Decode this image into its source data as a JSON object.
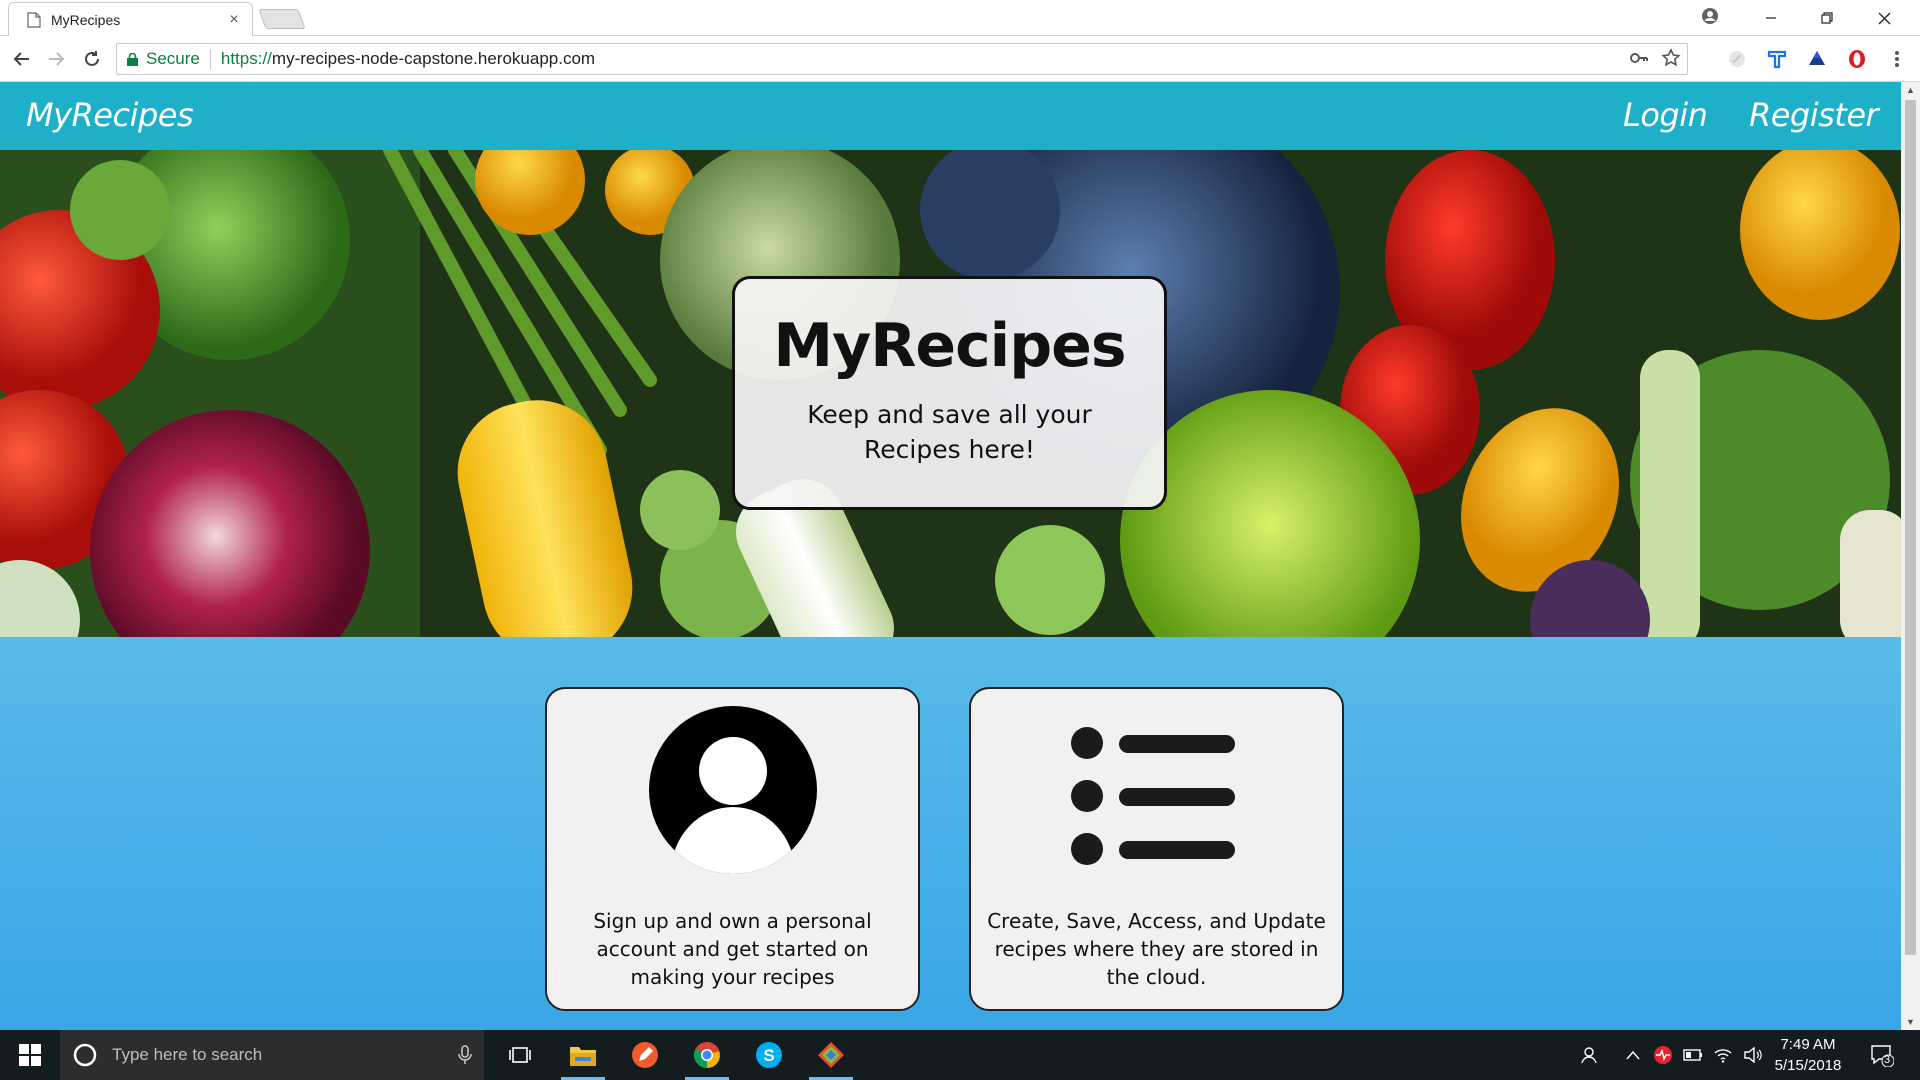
{
  "browser": {
    "tab_title": "MyRecipes",
    "tab_close": "×",
    "secure_label": "Secure",
    "url_scheme": "https://",
    "url_rest": "my-recipes-node-capstone.herokuapp.com"
  },
  "site": {
    "brand": "MyRecipes",
    "nav": {
      "login": "Login",
      "register": "Register"
    },
    "hero": {
      "title": "MyRecipes",
      "subtitle": "Keep and save all your Recipes here!"
    },
    "features": [
      {
        "icon": "user-avatar-icon",
        "text": "Sign up and own a personal account and get started on making your recipes"
      },
      {
        "icon": "list-icon",
        "text": "Create, Save, Access, and Update recipes where they are stored in the cloud."
      }
    ],
    "colors": {
      "navbar": "#1eb0c8",
      "page_bg_top": "#8ad4ef",
      "page_bg_bottom": "#39a6e6"
    }
  },
  "taskbar": {
    "search_placeholder": "Type here to search",
    "time": "7:49 AM",
    "date": "5/15/2018",
    "notification_count": "3"
  }
}
